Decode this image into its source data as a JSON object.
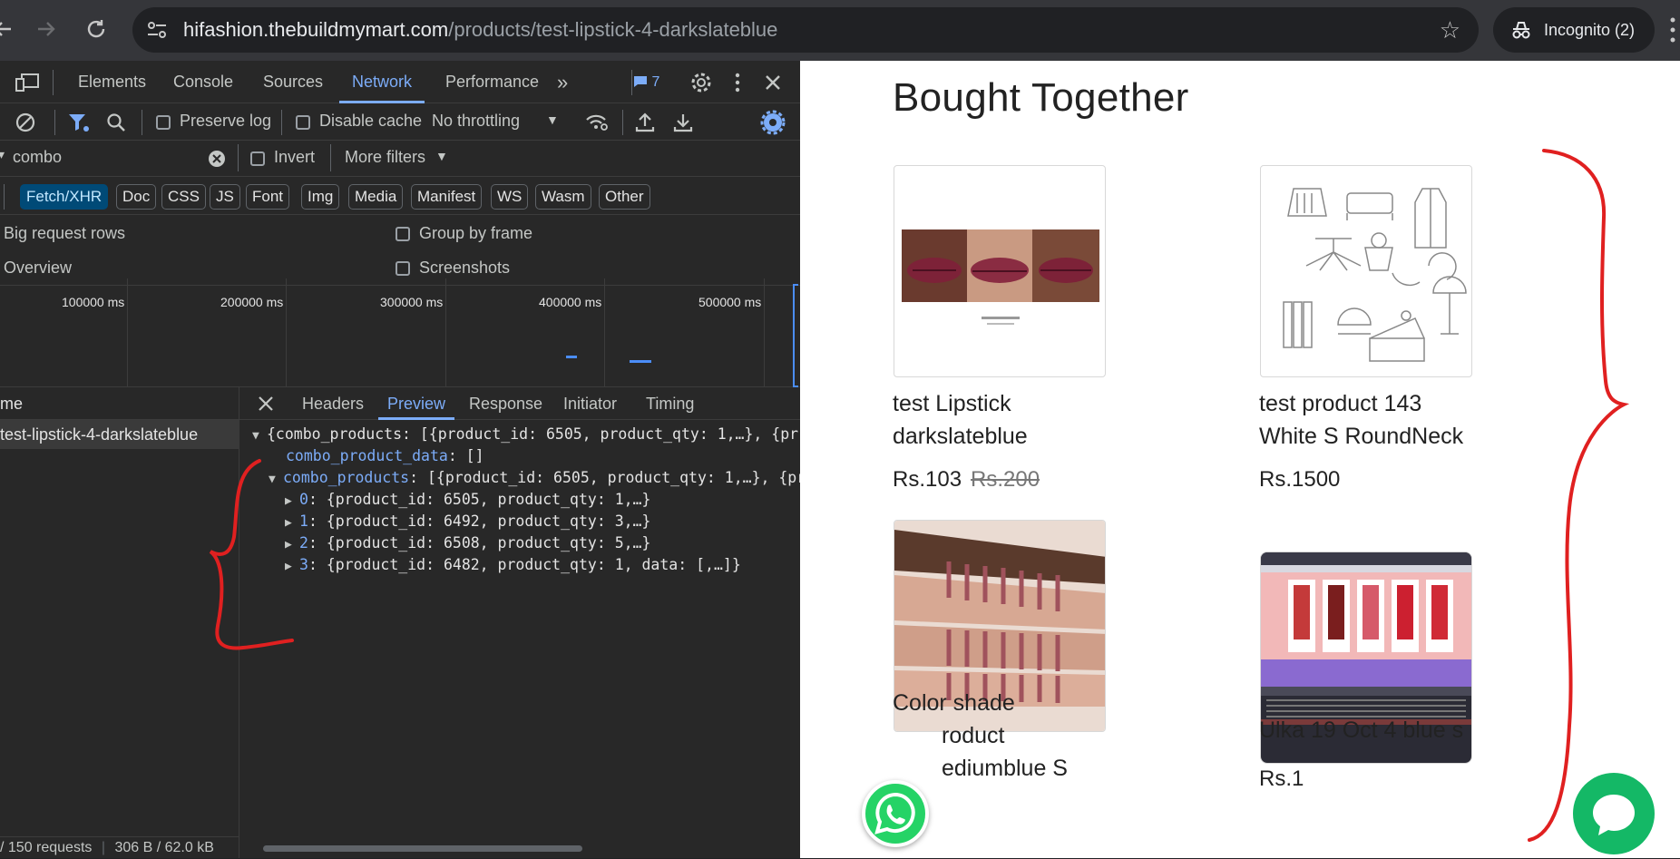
{
  "browser": {
    "url_host": "hifashion.thebuildmymart.com",
    "url_path": "/products/test-lipstick-4-darkslateblue",
    "incognito_label": "Incognito (2)"
  },
  "devtools": {
    "tabs": [
      "Elements",
      "Console",
      "Sources",
      "Network",
      "Performance"
    ],
    "active_tab": "Network",
    "issues_count": "7",
    "toolbar": {
      "preserve_log": "Preserve log",
      "disable_cache": "Disable cache",
      "throttling": "No throttling"
    },
    "filter": {
      "value": "combo",
      "invert": "Invert",
      "more_filters": "More filters"
    },
    "type_filters": [
      "Fetch/XHR",
      "Doc",
      "CSS",
      "JS",
      "Font",
      "Img",
      "Media",
      "Manifest",
      "WS",
      "Wasm",
      "Other"
    ],
    "active_type": "Fetch/XHR",
    "settings": {
      "big_request_rows": "Big request rows",
      "group_by_frame": "Group by frame",
      "overview": "Overview",
      "screenshots": "Screenshots"
    },
    "timeline_ticks": [
      "100000 ms",
      "200000 ms",
      "300000 ms",
      "400000 ms",
      "500000 ms"
    ],
    "request_list": {
      "header": "me",
      "row": "test-lipstick-4-darkslateblue",
      "status": "/ 150 requests",
      "transfer": "306 B / 62.0 kB"
    },
    "detail_tabs": [
      "Headers",
      "Preview",
      "Response",
      "Initiator",
      "Timing"
    ],
    "active_detail_tab": "Preview",
    "preview": {
      "root": "{combo_products: [{product_id: 6505, product_qty: 1,…}, {pr",
      "combo_product_data_key": "combo_product_data",
      "combo_product_data_val": ": []",
      "combo_products_key": "combo_products",
      "combo_products_val": ": [{product_id: 6505, product_qty: 1,…}, {pr",
      "items": [
        {
          "idx": "0",
          "text": ": {product_id: 6505, product_qty: 1,…}"
        },
        {
          "idx": "1",
          "text": ": {product_id: 6492, product_qty: 3,…}"
        },
        {
          "idx": "2",
          "text": ": {product_id: 6508, product_qty: 5,…}"
        },
        {
          "idx": "3",
          "text": ": {product_id: 6482, product_qty: 1, data: [,…]}"
        }
      ]
    }
  },
  "page": {
    "title": "Bought Together",
    "products": [
      {
        "name_line1": "test Lipstick",
        "name_line2": "darkslateblue",
        "price": "Rs.103",
        "old_price": "Rs.200"
      },
      {
        "name_line1": "test product 143",
        "name_line2": "White S RoundNeck",
        "price": "Rs.1500",
        "old_price": ""
      },
      {
        "name_line1": "Color shade",
        "name_line2": "roduct",
        "name_line3": "ediumblue S",
        "price": "",
        "old_price": ""
      },
      {
        "name_line1": "Ulka 19 Oct 4 blue s",
        "name_line2": "",
        "price": "Rs.1",
        "old_price": ""
      }
    ],
    "plus": "+"
  },
  "colors": {
    "accent": "#7cacf8",
    "annotation": "#e02020",
    "chat": "#14b866",
    "whatsapp": "#25d366"
  }
}
